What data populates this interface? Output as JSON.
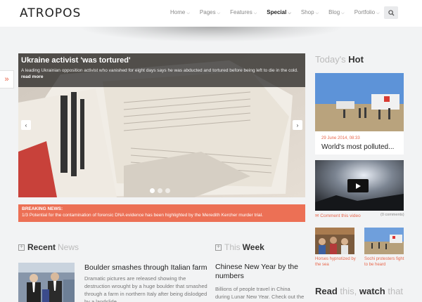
{
  "brand": {
    "logo": "ATROPOS"
  },
  "nav": [
    {
      "label": "Home",
      "active": false
    },
    {
      "label": "Pages",
      "active": false
    },
    {
      "label": "Features",
      "active": false
    },
    {
      "label": "Special",
      "active": true
    },
    {
      "label": "Shop",
      "active": false
    },
    {
      "label": "Blog",
      "active": false
    },
    {
      "label": "Portfolio",
      "active": false
    }
  ],
  "icons": {
    "search": "search-icon",
    "side_tab": "chevrons-right-icon",
    "comment": "comment-icon"
  },
  "slider": {
    "title": "Ukraine activist 'was tortured'",
    "description": "A leading Ukrainian opposition activist who vanished for eight days says he was abducted and tortured before being left to die in the cold.",
    "read_more": "read more",
    "slide_count": 3,
    "active_slide": 1
  },
  "breaking": {
    "label": "BREAKING NEWS:",
    "text": "1/3 Potential for the contamination of forensic DNA evidence has been highlighted by the Meredith Kercher murder trial."
  },
  "recent": {
    "title_bold": "Recent",
    "title_light": "News",
    "article_title": "Boulder smashes through Italian farm",
    "article_desc": "Dramatic pictures are released showing the destruction wrought by a huge boulder that smashed through a farm in northern Italy after being dislodged by a landslide."
  },
  "week": {
    "title_light": "This",
    "title_bold": "Week",
    "article_title": "Chinese New Year by the numbers",
    "article_desc": "Billions of people travel in China during Lunar New Year. Check out the mind-boggling numbers."
  },
  "hot": {
    "title_light": "Today's",
    "title_bold": "Hot",
    "date": "29 June 2014, 08:33",
    "headline": "World's most polluted..."
  },
  "video": {
    "comment_link": "Comment this video",
    "comment_count": "(0 comments)"
  },
  "thumbs": [
    {
      "caption": "Horses hypnotized by the sea"
    },
    {
      "caption": "Sochi protesters fight to be heard"
    }
  ],
  "read": {
    "word1": "Read",
    "word2": "this,",
    "word3": "watch",
    "word4": "that"
  },
  "colors": {
    "accent": "#e8654a",
    "breaking_bg": "#ec7055",
    "page_bg": "#f2f3f4"
  }
}
